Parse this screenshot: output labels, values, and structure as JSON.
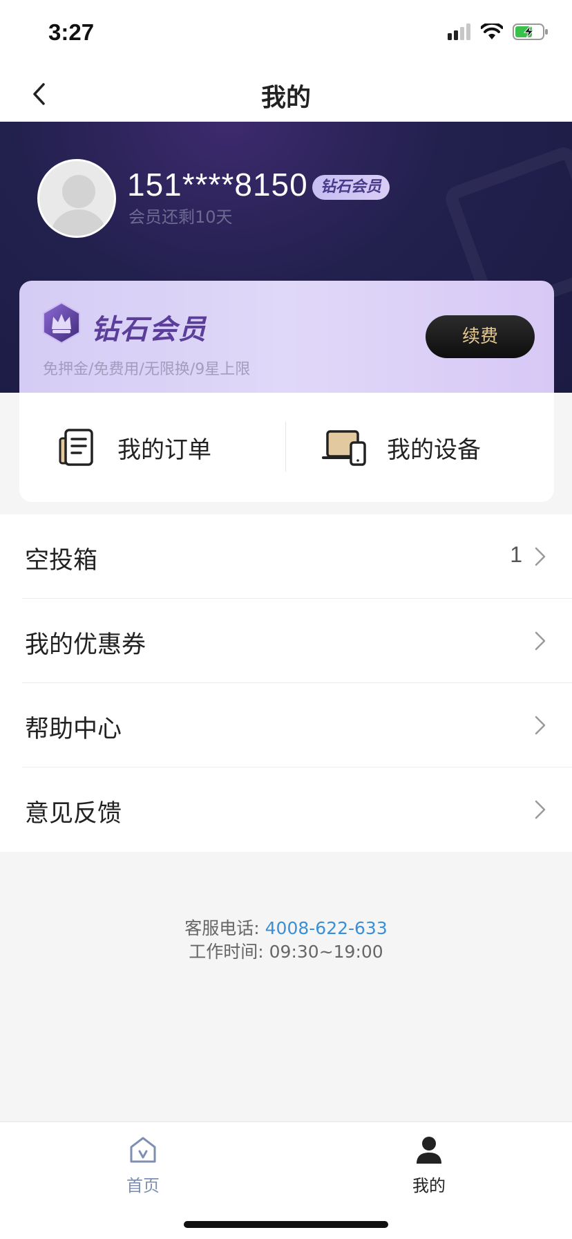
{
  "status_bar": {
    "time": "3:27"
  },
  "nav": {
    "title": "我的"
  },
  "profile": {
    "phone": "151****8150",
    "badge": "钻石会员",
    "remaining": "会员还剩10天"
  },
  "vip_card": {
    "title": "钻石会员",
    "benefits": "免押金/免费用/无限换/9星上限",
    "renew_label": "续费"
  },
  "quick_actions": {
    "orders_label": "我的订单",
    "devices_label": "我的设备"
  },
  "menu": {
    "items": [
      {
        "label": "空投箱",
        "count": "1"
      },
      {
        "label": "我的优惠券",
        "count": ""
      },
      {
        "label": "帮助中心",
        "count": ""
      },
      {
        "label": "意见反馈",
        "count": ""
      }
    ]
  },
  "service": {
    "phone_prefix": "客服电话:",
    "phone": "4008-622-633",
    "hours": "工作时间: 09:30~19:00"
  },
  "tab_bar": {
    "home_label": "首页",
    "mine_label": "我的"
  },
  "colors": {
    "hero_bg": "#1b1b44",
    "vip_purple": "#5a3e99",
    "renew_text": "#e3c892",
    "link_blue": "#3a8fd6"
  }
}
